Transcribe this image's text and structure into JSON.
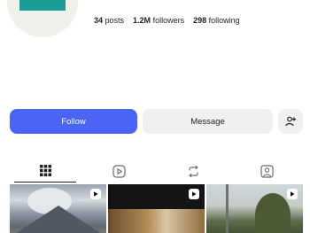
{
  "profile": {
    "stats": {
      "posts_count": "34",
      "posts_label": "posts",
      "followers_count": "1.2M",
      "followers_label": "followers",
      "following_count": "298",
      "following_label": "following"
    }
  },
  "actions": {
    "follow_label": "Follow",
    "message_label": "Message",
    "add_user_icon": "add-user-icon"
  },
  "tabs": [
    {
      "icon": "grid-icon",
      "active": true
    },
    {
      "icon": "reels-icon",
      "active": false
    },
    {
      "icon": "reposts-icon",
      "active": false
    },
    {
      "icon": "tagged-icon",
      "active": false
    }
  ],
  "colors": {
    "accent": "#4a64f5",
    "secondary_button": "#eef0f2",
    "logo": "#1c9a97"
  }
}
